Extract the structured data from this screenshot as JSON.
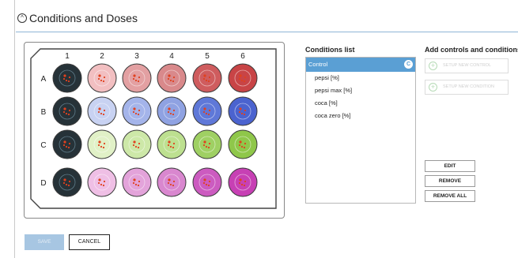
{
  "panel": {
    "title": "Conditions and Doses",
    "toggle_icon": "chevron-up-icon"
  },
  "plate": {
    "columns": [
      "1",
      "2",
      "3",
      "4",
      "5",
      "6"
    ],
    "rows": [
      {
        "label": "A",
        "colors": [
          "#263238",
          "#f2bfc1",
          "#e3a0a2",
          "#d9898b",
          "#cf5c5e",
          "#c84446"
        ]
      },
      {
        "label": "B",
        "colors": [
          "#263238",
          "#c8d2f2",
          "#a4b4ea",
          "#8fa2e2",
          "#5f78d8",
          "#4b63cf"
        ]
      },
      {
        "label": "C",
        "colors": [
          "#263238",
          "#e1f1c7",
          "#cde8a8",
          "#bde090",
          "#9fd063",
          "#8fc74a"
        ]
      },
      {
        "label": "D",
        "colors": [
          "#263238",
          "#efbfe5",
          "#e3a3da",
          "#d987cf",
          "#cc5bc0",
          "#c740b4"
        ]
      }
    ]
  },
  "conditions": {
    "title": "Conditions list",
    "items": [
      {
        "label": "Control",
        "selected": true,
        "badge": "C"
      },
      {
        "label": "pepsi [%]"
      },
      {
        "label": "pepsi max [%]"
      },
      {
        "label": "coca [%]"
      },
      {
        "label": "coca zero [%]"
      }
    ]
  },
  "add": {
    "title": "Add controls and conditions",
    "setup_control": "SETUP NEW CONTROL",
    "setup_condition": "SETUP NEW CONDITION"
  },
  "actions": {
    "edit": "EDIT",
    "remove": "REMOVE",
    "remove_all": "REMOVE ALL"
  },
  "footer": {
    "save": "SAVE",
    "cancel": "CANCEL"
  }
}
